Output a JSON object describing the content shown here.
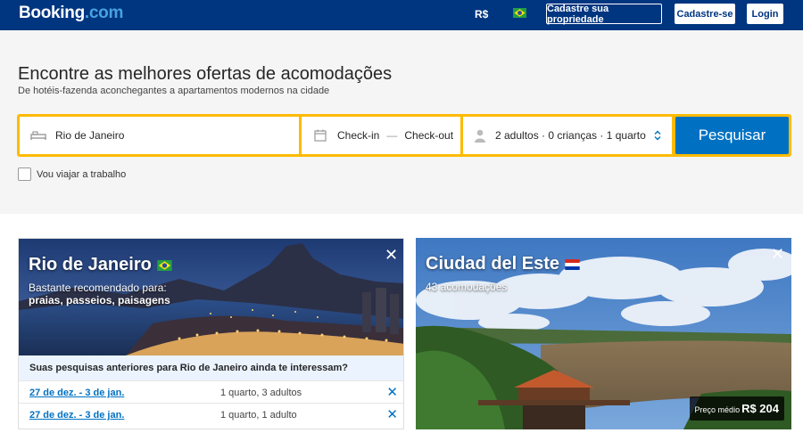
{
  "header": {
    "logo_main": "Booking",
    "logo_suffix": ".com",
    "currency": "R$",
    "list_property": "Cadastre sua propriedade",
    "register": "Cadastre-se",
    "login": "Login"
  },
  "hero": {
    "title": "Encontre as melhores ofertas de acomodações",
    "subtitle": "De hotéis-fazenda aconchegantes a apartamentos modernos na cidade"
  },
  "search": {
    "destination": "Rio de Janeiro",
    "checkin": "Check-in",
    "separator": "—",
    "checkout": "Check-out",
    "guests": "2 adultos · 0 crianças · 1 quarto",
    "button": "Pesquisar",
    "work_trip": "Vou viajar a trabalho"
  },
  "cards": {
    "rio": {
      "city": "Rio de Janeiro",
      "recommended": "Bastante recomendado para:",
      "tags": "praias, passeios, paisagens",
      "previous_title": "Suas pesquisas anteriores para Rio de Janeiro ainda te interessam?",
      "rows": [
        {
          "dates": "27 de dez. - 3 de jan.",
          "info": "1 quarto, 3 adultos"
        },
        {
          "dates": "27 de dez. - 3 de jan.",
          "info": "1 quarto, 1 adulto"
        }
      ]
    },
    "ciudad": {
      "city": "Ciudad del Este",
      "count": "43 acomodações",
      "price_label": "Preço médio",
      "price": "R$ 204"
    }
  },
  "colors": {
    "brand_navy": "#003580",
    "search_yellow": "#febb02",
    "button_blue": "#0071c2"
  }
}
